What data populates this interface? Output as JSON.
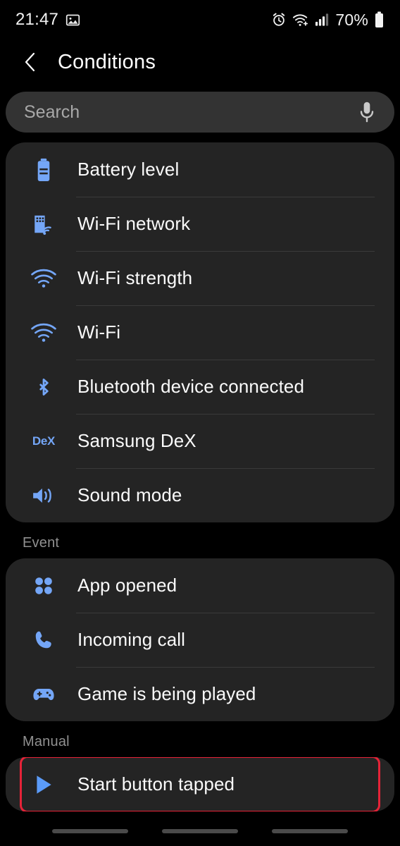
{
  "status_bar": {
    "time": "21:47",
    "left_icons": [
      {
        "name": "image-icon"
      }
    ],
    "right_icons": [
      {
        "name": "alarm-icon"
      },
      {
        "name": "wifi-calling-icon"
      },
      {
        "name": "cellular-signal-icon"
      }
    ],
    "battery_percent": "70%",
    "battery_icon": "battery-icon"
  },
  "app_bar": {
    "back_icon": "back-chevron-icon",
    "title": "Conditions"
  },
  "search": {
    "placeholder": "Search",
    "value": "",
    "mic_icon": "microphone-icon"
  },
  "sections": [
    {
      "label": "",
      "items": [
        {
          "icon": "battery-level-icon",
          "label": "Battery level"
        },
        {
          "icon": "wifi-network-icon",
          "label": "Wi-Fi network"
        },
        {
          "icon": "wifi-strength-icon",
          "label": "Wi-Fi strength"
        },
        {
          "icon": "wifi-icon",
          "label": "Wi-Fi"
        },
        {
          "icon": "bluetooth-icon",
          "label": "Bluetooth device connected"
        },
        {
          "icon": "samsung-dex-icon",
          "label": "Samsung DeX",
          "glyph": "DeX"
        },
        {
          "icon": "sound-mode-icon",
          "label": "Sound mode"
        }
      ]
    },
    {
      "label": "Event",
      "items": [
        {
          "icon": "app-opened-icon",
          "label": "App opened"
        },
        {
          "icon": "phone-call-icon",
          "label": "Incoming call"
        },
        {
          "icon": "gamepad-icon",
          "label": "Game is being played"
        }
      ]
    },
    {
      "label": "Manual",
      "items": [
        {
          "icon": "play-triangle-icon",
          "label": "Start button tapped",
          "highlighted": true
        }
      ]
    }
  ],
  "colors": {
    "accent_blue": "#74a6f7",
    "highlight_red": "#e62338",
    "card_bg": "#242424",
    "page_bg": "#000000",
    "search_bg": "#333333",
    "section_label": "#909090"
  },
  "nav_bar": {
    "pills": [
      "recents-pill",
      "home-pill",
      "back-pill"
    ]
  }
}
